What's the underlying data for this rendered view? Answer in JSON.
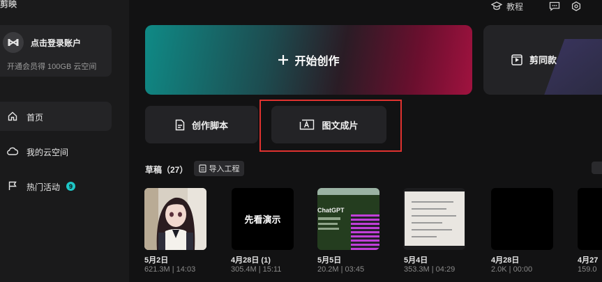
{
  "app": {
    "title": "剪映"
  },
  "topbar": {
    "tutorial_label": "教程"
  },
  "sidebar": {
    "login": {
      "title": "点击登录账户",
      "subtitle": "开通会员得 100GB 云空间"
    },
    "nav": [
      {
        "label": "首页",
        "icon": "home-icon"
      },
      {
        "label": "我的云空间",
        "icon": "cloud-icon"
      },
      {
        "label": "热门活动",
        "icon": "flag-icon",
        "badge": "9"
      }
    ]
  },
  "main": {
    "start_label": "开始创作",
    "template_label": "剪同款",
    "tools": [
      {
        "label": "创作脚本",
        "icon": "script-icon"
      },
      {
        "label": "图文成片",
        "icon": "text-to-video-icon"
      }
    ]
  },
  "drafts": {
    "title": "草稿（27）",
    "import_label": "导入工程",
    "items": [
      {
        "title": "5月2日",
        "meta": "621.3M | 14:03",
        "thumb": "anime-girl"
      },
      {
        "title": "4月28日 (1)",
        "meta": "305.4M | 15:11",
        "thumb": "text",
        "thumb_text": "先看演示"
      },
      {
        "title": "5月5日",
        "meta": "20.2M | 03:45",
        "thumb": "chatgpt",
        "thumb_text": "ChatGPT"
      },
      {
        "title": "5月4日",
        "meta": "353.3M | 04:29",
        "thumb": "document"
      },
      {
        "title": "4月28日",
        "meta": "2.0K | 00:00",
        "thumb": "black"
      },
      {
        "title": "4月27",
        "meta": "159.0",
        "thumb": "black"
      }
    ]
  }
}
